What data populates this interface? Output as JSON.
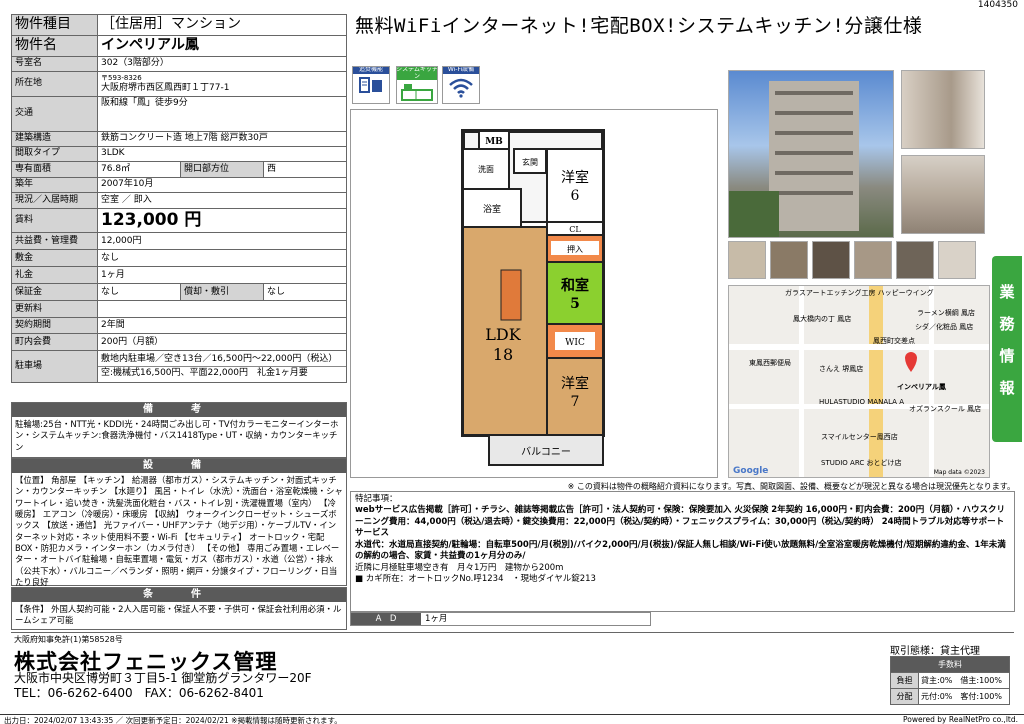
{
  "page_id": "1404350",
  "headline": "無料WiFiインターネット!宅配BOX!システムキッチン!分譲仕様",
  "spec": {
    "type_label": "物件種目",
    "type_value": "［住居用］マンション",
    "name_label": "物件名",
    "name_value": "インペリアル鳳",
    "room_label": "号室名",
    "room_value": "302（3階部分）",
    "address_label": "所在地",
    "postal": "〒593-8326",
    "address": "大阪府堺市西区鳳西町１丁77-1",
    "transport_label": "交通",
    "transport": "阪和線「鳳」徒歩9分",
    "structure_label": "建築構造",
    "structure": "鉄筋コンクリート造 地上7階 総戸数30戸",
    "layout_label": "間取タイプ",
    "layout": "3LDK",
    "area_label": "専有面積",
    "area": "76.8㎡",
    "direction_label": "開口部方位",
    "direction": "西",
    "built_label": "築年",
    "built": "2007年10月",
    "status_label": "現況／入居時期",
    "status": "空室 ／ 即入",
    "rent_label": "賃料",
    "rent": "123,000 円",
    "fee_label": "共益費・管理費",
    "fee": "12,000円",
    "deposit_label": "敷金",
    "deposit": "なし",
    "key_label": "礼金",
    "key_money": "1ヶ月",
    "guarantee_label": "保証金",
    "guarantee": "なし",
    "amort_label": "償却・敷引",
    "amort": "なし",
    "renewal_label": "更新料",
    "renewal": "",
    "contract_label": "契約期間",
    "contract": "2年間",
    "assoc_label": "町内会費",
    "assoc": "200円（月額）",
    "parking_label": "駐車場",
    "parking1": "敷地内駐車場／空き13台／16,500円～22,000円（税込）",
    "parking2": "空:機械式16,500円、平面22,000円　礼金1ヶ月要"
  },
  "remarks": {
    "title": "備　考",
    "body": "駐輪場:25台・NTT光・KDDI光・24時間ごみ出し可・TV付カラーモニターインターホン・システムキッチン:食器洗浄機付・バス1418Type・UT・収納・カウンターキッチン"
  },
  "facilities": {
    "title": "設　備",
    "body": "【位置】 角部屋 【キッチン】 給湯器（都市ガス）・システムキッチン・対面式キッチン・カウンターキッチン 【水廻り】 風呂・トイレ（水洗）・洗面台・浴室乾燥機・シャワートイレ・追い焚き・洗髪洗面化粧台・バス・トイレ別・洗濯機置場（室内） 【冷暖房】 エアコン（冷暖房）・床暖房 【収納】 ウォークインクローゼット・シューズボックス 【放送・通信】 光ファイバー・UHFアンテナ（地デジ用）・ケーブルTV・インターネット対応・ネット使用料不要・Wi-Fi 【セキュリティ】 オートロック・宅配BOX・防犯カメラ・インターホン（カメラ付き） 【その他】 専用ごみ置場・エレベーター・オートバイ駐輪場・自転車置場・電気・ガス（都市ガス）・水道（公営）・排水（公共下水）・バルコニー／ベランダ・照明・網戸・分譲タイプ・フローリング・日当たり良好"
  },
  "conditions": {
    "title": "条　件",
    "body": "【条件】 外国人契約可能・2人入居可能・保証人不要・子供可・保証会社利用必須・ルームシェア可能"
  },
  "icons": [
    {
      "name": "追焚機能",
      "color": "#2a4f9a"
    },
    {
      "name": "システムキッチン",
      "color": "#3aa640"
    },
    {
      "name": "Wi-Fi設備",
      "color": "#2a4f9a"
    }
  ],
  "floorplan": {
    "rooms": {
      "mb": "MB",
      "genkan": "玄関",
      "senmen": "洗面",
      "yokushitsu": "浴室",
      "youshitsu6": "洋室",
      "six": "6",
      "wc1": "WC",
      "cl": "CL",
      "oshiire": "押入",
      "shuno": "収納",
      "washitsu": "和室",
      "five": "5",
      "ldk": "LDK",
      "eighteen": "18",
      "wic": "WIC",
      "youshitsu7": "洋室",
      "seven": "7",
      "balcony": "バルコニー"
    }
  },
  "fp_note": "※ この資料は物件の概略紹介資料になります。写真、間取図面、設備、概要などが現況と異なる場合は現況優先となります。",
  "map_labels": [
    "ガラスアートエッチング工房 ハッピーウイング",
    "ラーメン横綱 鳳店",
    "鳳大橋内の丁 鳳店",
    "シダ／化粧品 鳳店",
    "鳳西町交差点",
    "東鳳西郵便局",
    "さんえ 堺鳳店",
    "インペリアル鳳",
    "HULASTUDIO MANALA A",
    "オズランスクール 鳳店",
    "スマイルセンター鳳西店",
    "STUDIO ARC おとどけ店",
    "Google",
    "Map data ©2023"
  ],
  "side_tab": "業務情報",
  "remarks_box": {
    "title": "特記事項：",
    "line1": "webサービス広告掲載［許可］・チラシ、雑誌等掲載広告［許可］・法人契約可・保険：保険要加入 火災保険 2年契約 16,000円・町内会費：200円（月額）・ハウスクリーニング費用：44,000円（税込/退去時）・鍵交換費用：22,000円（税込/契約時）・フェニックスプライム：30,000円（税込/契約時） 24時間トラブル対応等サポートサービス",
    "line2": "水道代：水道局直接契約/駐輪場：自転車500円/月(税別)/バイク2,000円/月(税抜)/保証人無し相談/Wi-Fi使い放題無料/全室浴室暖房乾燥機付/短期解約違約金、1年未満の解約の場合、家賃・共益費の1ヶ月分のみ/",
    "line3": "近隣に月極駐車場空き有　月々1万円　建物から200m",
    "line4": "■ カギ所在：オートロックNo.呼1234　・現地ダイヤル錠213"
  },
  "ad": {
    "label": "A　D",
    "value": "1ヶ月"
  },
  "footer": {
    "license": "大阪府知事免許(1)第58528号",
    "company": "株式会社フェニックス管理",
    "address": "大阪市中央区博労町３丁目5-1 御堂筋グランタワー20F",
    "tel": "TEL：06-6262-6400　FAX：06-6262-8401",
    "torihiki": "取引態様：貸主代理",
    "fee_title": "手数料",
    "burden_label": "負担",
    "burden_value": "貸主:0%　借主:100%",
    "split_label": "分配",
    "split_value": "元付:0%　客付:100%",
    "printed": "出力日：2024/02/07 13:43:35 ／ 次回更新予定日：2024/02/21 ※掲載情報は随時更新されます。",
    "powered": "Powered by RealNetPro co.,ltd."
  }
}
